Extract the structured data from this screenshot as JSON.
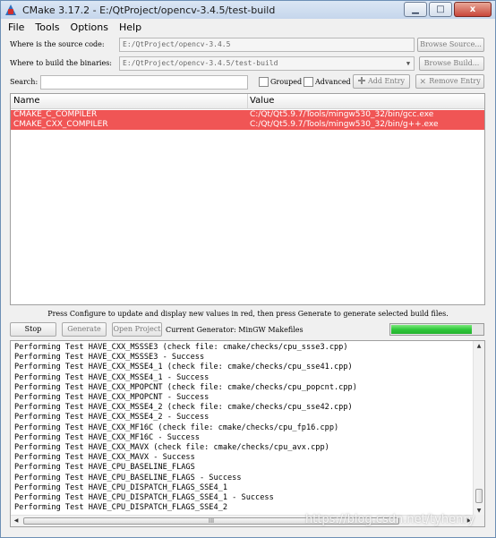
{
  "window": {
    "title": "CMake 3.17.2 - E:/QtProject/opencv-3.4.5/test-build",
    "minimize": "▁",
    "maximize": "□",
    "close": "x"
  },
  "menu": [
    "File",
    "Tools",
    "Options",
    "Help"
  ],
  "source": {
    "label": "Where is the source code:",
    "value": "E:/QtProject/opencv-3.4.5",
    "browse": "Browse Source..."
  },
  "build": {
    "label": "Where to build the binaries:",
    "value": "E:/QtProject/opencv-3.4.5/test-build",
    "browse": "Browse Build..."
  },
  "search": {
    "label": "Search:",
    "value": "",
    "grouped": "Grouped",
    "advanced": "Advanced",
    "add_entry": "Add Entry",
    "remove_entry": "Remove Entry"
  },
  "table": {
    "col_name": "Name",
    "col_value": "Value",
    "rows": [
      {
        "name": "CMAKE_C_COMPILER",
        "value": "C:/Qt/Qt5.9.7/Tools/mingw530_32/bin/gcc.exe"
      },
      {
        "name": "CMAKE_CXX_COMPILER",
        "value": "C:/Qt/Qt5.9.7/Tools/mingw530_32/bin/g++.exe"
      }
    ],
    "highlight_color": "#f05555"
  },
  "hint": "Press Configure to update and display new values in red, then press Generate to generate selected build files.",
  "actions": {
    "stop": "Stop",
    "generate": "Generate",
    "open_project": "Open Project",
    "current_generator": "Current Generator: MinGW Makefiles"
  },
  "progress": {
    "fraction": 0.88,
    "color": "#2fc83a"
  },
  "output_lines": [
    "Performing Test HAVE_CXX_MSSSE3 (check file: cmake/checks/cpu_ssse3.cpp)",
    "Performing Test HAVE_CXX_MSSSE3 - Success",
    "Performing Test HAVE_CXX_MSSE4_1 (check file: cmake/checks/cpu_sse41.cpp)",
    "Performing Test HAVE_CXX_MSSE4_1 - Success",
    "Performing Test HAVE_CXX_MPOPCNT (check file: cmake/checks/cpu_popcnt.cpp)",
    "Performing Test HAVE_CXX_MPOPCNT - Success",
    "Performing Test HAVE_CXX_MSSE4_2 (check file: cmake/checks/cpu_sse42.cpp)",
    "Performing Test HAVE_CXX_MSSE4_2 - Success",
    "Performing Test HAVE_CXX_MF16C (check file: cmake/checks/cpu_fp16.cpp)",
    "Performing Test HAVE_CXX_MF16C - Success",
    "Performing Test HAVE_CXX_MAVX (check file: cmake/checks/cpu_avx.cpp)",
    "Performing Test HAVE_CXX_MAVX - Success",
    "Performing Test HAVE_CPU_BASELINE_FLAGS",
    "Performing Test HAVE_CPU_BASELINE_FLAGS - Success",
    "Performing Test HAVE_CPU_DISPATCH_FLAGS_SSE4_1",
    "Performing Test HAVE_CPU_DISPATCH_FLAGS_SSE4_1 - Success",
    "Performing Test HAVE_CPU_DISPATCH_FLAGS_SSE4_2"
  ],
  "scroll": {
    "hthumb_grip": "III"
  },
  "watermark": "https://blog.csdn.net/tyhenry"
}
